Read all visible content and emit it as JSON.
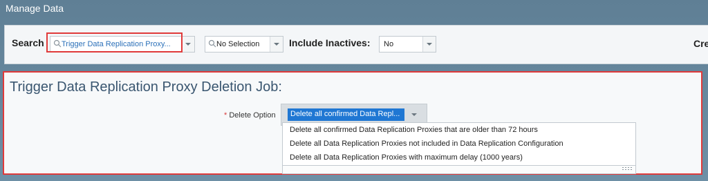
{
  "app": {
    "title": "Manage Data"
  },
  "search": {
    "label": "Search",
    "value": "Trigger Data Replication Proxy...",
    "secondary_value": "No Selection",
    "include_inactives_label": "Include Inactives:",
    "include_inactives_value": "No",
    "right_label": "Cre"
  },
  "panel": {
    "title": "Trigger Data Replication Proxy Deletion Job:",
    "delete_option": {
      "required_marker": "*",
      "label": "Delete Option",
      "selected": "Delete all confirmed Data Repl...",
      "options": [
        "Delete all confirmed Data Replication Proxies that are older than 72 hours",
        "Delete all Data Replication Proxies not included in Data Replication Configuration",
        "Delete all Data Replication Proxies with maximum delay (1000 years)"
      ]
    }
  },
  "colors": {
    "header_bg": "#5f7f95",
    "highlight_border": "#e03a3a",
    "selection_bg": "#1f77d3",
    "panel_title": "#3a5670"
  },
  "icons": [
    "search-icon",
    "chevron-down-icon",
    "resize-grip-icon"
  ]
}
